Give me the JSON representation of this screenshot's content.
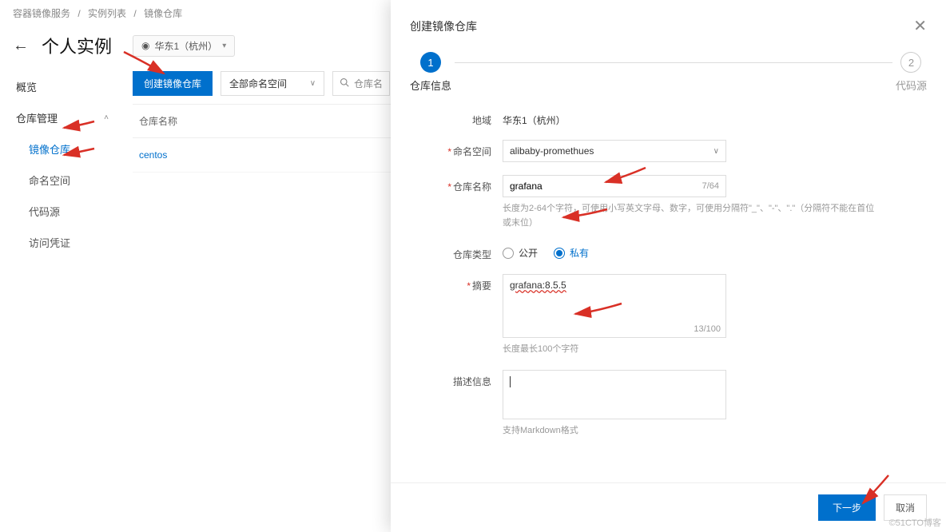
{
  "breadcrumb": {
    "a": "容器镜像服务",
    "b": "实例列表",
    "c": "镜像仓库"
  },
  "header": {
    "title": "个人实例",
    "region": "华东1（杭州）"
  },
  "sidebar": {
    "overview": "概览",
    "group": "仓库管理",
    "items": [
      "镜像仓库",
      "命名空间",
      "代码源",
      "访问凭证"
    ]
  },
  "toolbar": {
    "create": "创建镜像仓库",
    "namespace_all": "全部命名空间",
    "search_ph": "仓库名"
  },
  "table": {
    "header": "仓库名称",
    "row0": "centos"
  },
  "drawer": {
    "title": "创建镜像仓库",
    "step1": "仓库信息",
    "step2": "代码源",
    "step1_num": "1",
    "step2_num": "2",
    "region_label": "地域",
    "region_value": "华东1（杭州）",
    "ns_label": "命名空间",
    "ns_value": "alibaby-promethues",
    "name_label": "仓库名称",
    "name_value": "grafana",
    "name_counter": "7/64",
    "name_help": "长度为2-64个字符，可使用小写英文字母、数字，可使用分隔符\"_\"、\"-\"、\".\"（分隔符不能在首位或末位）",
    "type_label": "仓库类型",
    "type_public": "公开",
    "type_private": "私有",
    "summary_label": "摘要",
    "summary_value": "grafana:8.5.5",
    "summary_counter": "13/100",
    "summary_help": "长度最长100个字符",
    "desc_label": "描述信息",
    "desc_help": "支持Markdown格式",
    "next": "下一步",
    "cancel": "取消"
  },
  "watermark": "©51CTO博客"
}
